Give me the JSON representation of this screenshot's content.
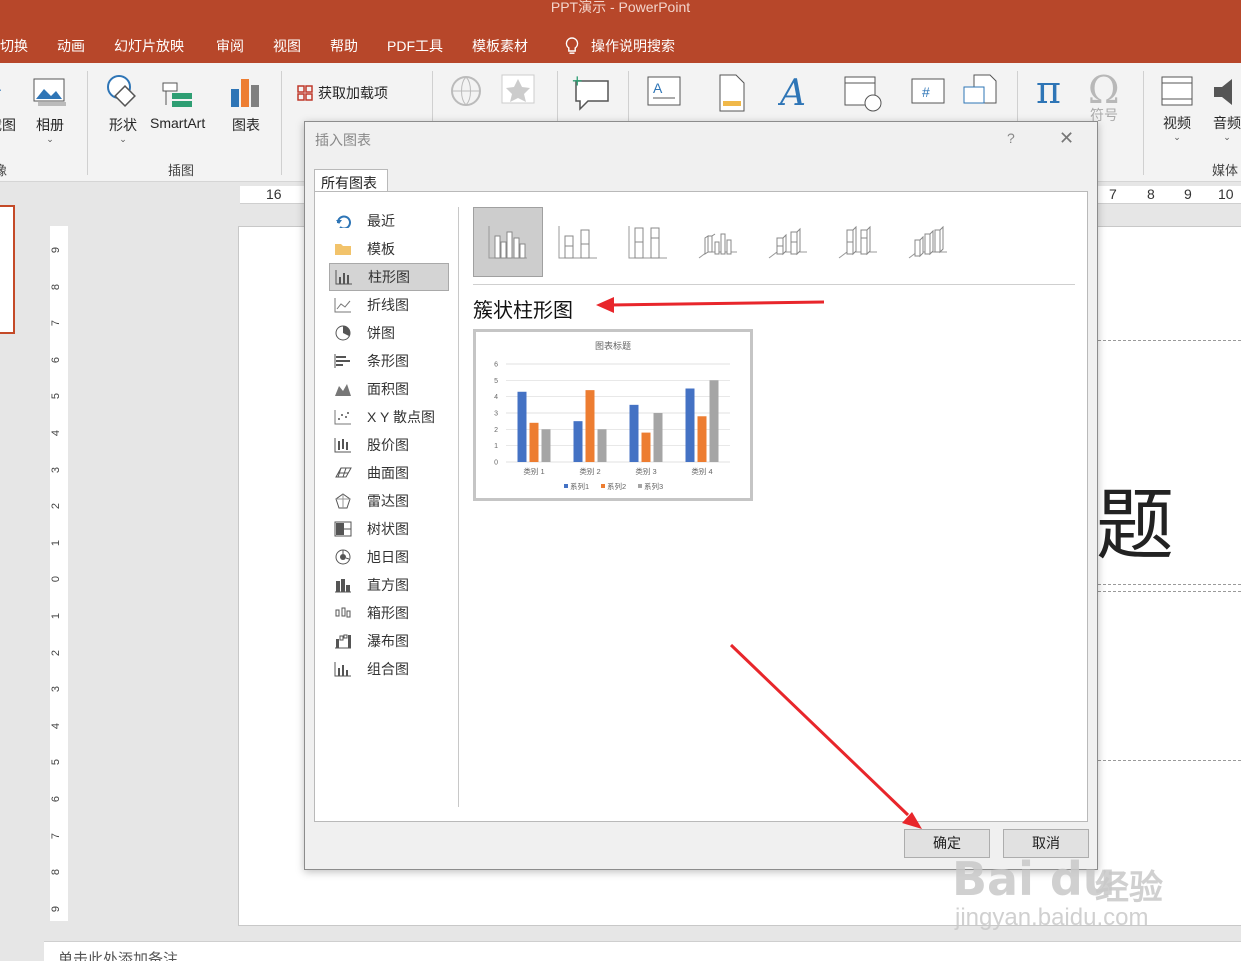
{
  "app": {
    "title": "PPT演示 - PowerPoint"
  },
  "tabs": [
    "切换",
    "动画",
    "幻灯片放映",
    "审阅",
    "视图",
    "帮助",
    "PDF工具",
    "模板素材"
  ],
  "tell_me": "操作说明搜索",
  "ribbon": {
    "screenshot_partial": "截图",
    "album": "相册",
    "images_group_partial": "像",
    "shapes": "形状",
    "smartart": "SmartArt",
    "chart": "图表",
    "illustrations_group": "插图",
    "get_addins": "获取加载项",
    "link_partial": "链",
    "action_partial": "动作",
    "comment_partial": "批注",
    "text_partial": "文本框 页眉和页脚 艺术字 日期和时间 幻灯片 对象",
    "equation_partial": "公式",
    "symbol": "符号",
    "video": "视频",
    "audio": "音频",
    "media_group_partial": "媒体"
  },
  "ruler": {
    "top_left": "16",
    "top_right": [
      "7",
      "8",
      "9",
      "10"
    ],
    "vertical": [
      "9",
      "8",
      "7",
      "6",
      "5",
      "4",
      "3",
      "2",
      "1",
      "0",
      "1",
      "2",
      "3",
      "4",
      "5",
      "6",
      "7",
      "8",
      "9"
    ]
  },
  "slide": {
    "title_visible_char": "题",
    "notes_placeholder": "单击此处添加备注"
  },
  "dialog": {
    "title": "插入图表",
    "help": "?",
    "close": "✕",
    "tab": "所有图表",
    "categories": [
      {
        "label": "最近",
        "icon": "recent-icon"
      },
      {
        "label": "模板",
        "icon": "folder-icon"
      },
      {
        "label": "柱形图",
        "icon": "column-chart-icon",
        "selected": true
      },
      {
        "label": "折线图",
        "icon": "line-chart-icon"
      },
      {
        "label": "饼图",
        "icon": "pie-chart-icon"
      },
      {
        "label": "条形图",
        "icon": "bar-chart-icon"
      },
      {
        "label": "面积图",
        "icon": "area-chart-icon"
      },
      {
        "label": "X Y 散点图",
        "icon": "scatter-chart-icon"
      },
      {
        "label": "股价图",
        "icon": "stock-chart-icon"
      },
      {
        "label": "曲面图",
        "icon": "surface-chart-icon"
      },
      {
        "label": "雷达图",
        "icon": "radar-chart-icon"
      },
      {
        "label": "树状图",
        "icon": "treemap-chart-icon"
      },
      {
        "label": "旭日图",
        "icon": "sunburst-chart-icon"
      },
      {
        "label": "直方图",
        "icon": "histogram-chart-icon"
      },
      {
        "label": "箱形图",
        "icon": "boxplot-chart-icon"
      },
      {
        "label": "瀑布图",
        "icon": "waterfall-chart-icon"
      },
      {
        "label": "组合图",
        "icon": "combo-chart-icon"
      }
    ],
    "subtype_name": "簇状柱形图",
    "subtypes": [
      "clustered-column",
      "stacked-column",
      "100-stacked-column",
      "3d-clustered-column",
      "3d-stacked-column",
      "3d-100-stacked-column",
      "3d-column"
    ],
    "ok": "确定",
    "cancel": "取消"
  },
  "chart_data": {
    "type": "bar",
    "title": "图表标题",
    "categories": [
      "类别 1",
      "类别 2",
      "类别 3",
      "类别 4"
    ],
    "series": [
      {
        "name": "系列1",
        "values": [
          4.3,
          2.5,
          3.5,
          4.5
        ],
        "color": "#4472c4"
      },
      {
        "name": "系列2",
        "values": [
          2.4,
          4.4,
          1.8,
          2.8
        ],
        "color": "#ed7d31"
      },
      {
        "name": "系列3",
        "values": [
          2,
          2,
          3,
          5
        ],
        "color": "#a5a5a5"
      }
    ],
    "ylim": [
      0,
      6
    ],
    "yticks": [
      "0",
      "1",
      "2",
      "3",
      "4",
      "5",
      "6"
    ],
    "grid": true,
    "legend": "bottom"
  },
  "watermark": {
    "brand": "Bai du",
    "cn": "经验",
    "url": "jingyan.baidu.com"
  },
  "colors": {
    "accent": "#b7472a",
    "annotation_arrow": "#e8262b"
  }
}
